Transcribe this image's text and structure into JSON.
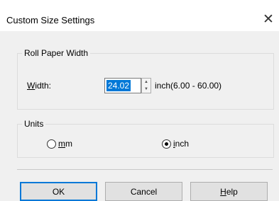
{
  "window": {
    "title": "Custom Size Settings",
    "close_icon": "close-icon"
  },
  "roll_paper_width": {
    "group_label": "Roll Paper Width",
    "width_label_underlined": "W",
    "width_label_rest": "idth:",
    "width_value": "24.02",
    "range_text": "inch(6.00 - 60.00)"
  },
  "units": {
    "group_label": "Units",
    "mm_underlined": "m",
    "mm_rest": "m",
    "inch_underlined": "i",
    "inch_rest": "nch",
    "selected": "inch"
  },
  "buttons": {
    "ok": "OK",
    "cancel": "Cancel",
    "help_underlined": "H",
    "help_rest": "elp"
  },
  "colors": {
    "selection": "#0078d7",
    "background": "#f0f0f0"
  }
}
